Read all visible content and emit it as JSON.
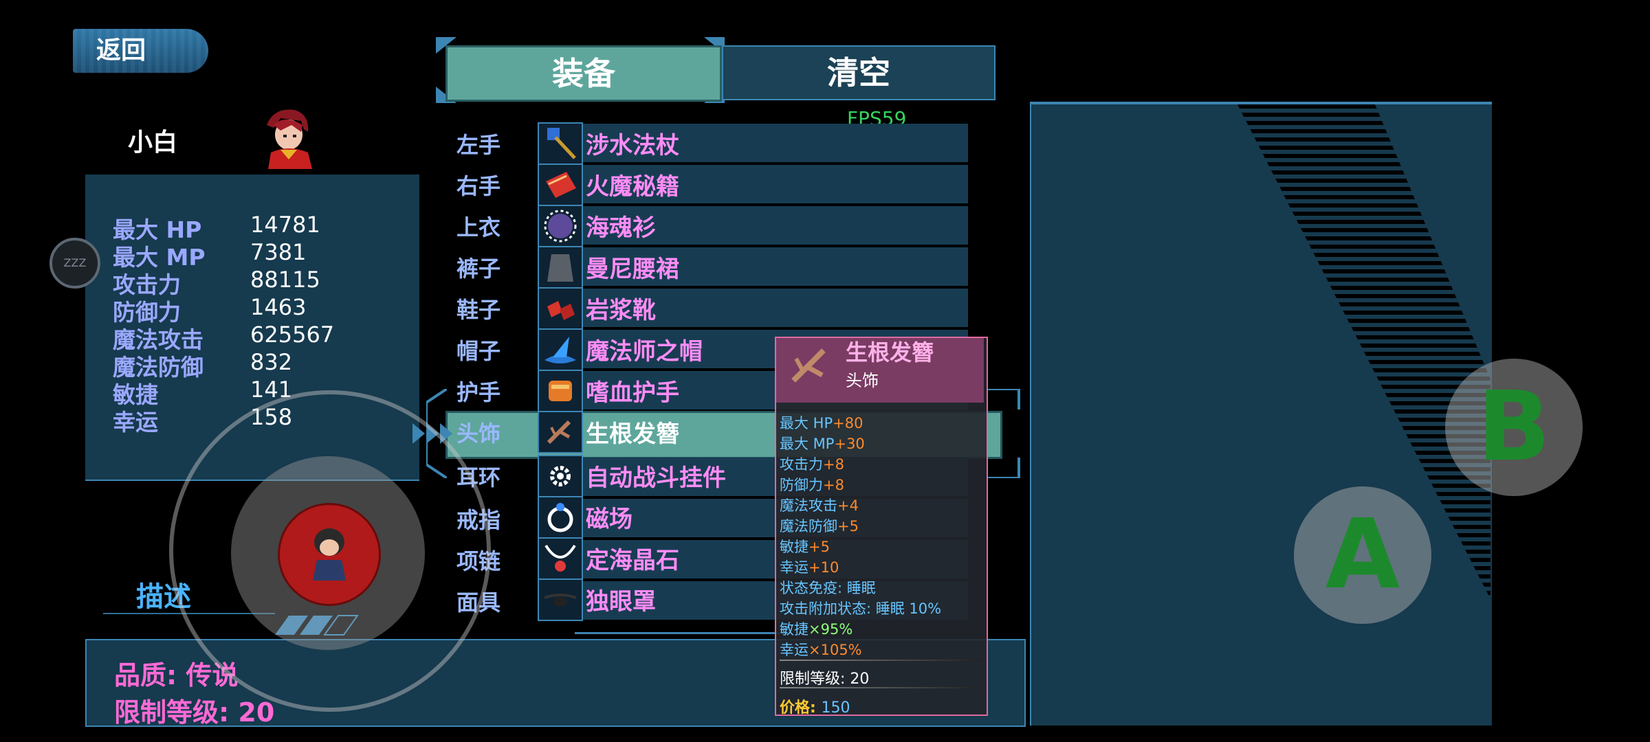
{
  "header": {
    "back_label": "返回",
    "tabs": [
      {
        "label": "装备",
        "active": true
      },
      {
        "label": "清空",
        "active": false
      }
    ],
    "fps": "FPS59"
  },
  "character": {
    "name": "小白",
    "stats": [
      {
        "label": "最大 HP",
        "value": "14781"
      },
      {
        "label": "最大 MP",
        "value": "7381"
      },
      {
        "label": "攻击力",
        "value": "88115"
      },
      {
        "label": "防御力",
        "value": "1463"
      },
      {
        "label": "魔法攻击",
        "value": "625567"
      },
      {
        "label": "魔法防御",
        "value": "832"
      },
      {
        "label": "敏捷",
        "value": "141"
      },
      {
        "label": "幸运",
        "value": "158"
      }
    ]
  },
  "equipment": {
    "slots": [
      {
        "slot": "左手",
        "item": "涉水法杖",
        "icon": "staff-icon"
      },
      {
        "slot": "右手",
        "item": "火魔秘籍",
        "icon": "spellbook-icon"
      },
      {
        "slot": "上衣",
        "item": "海魂衫",
        "icon": "shirt-icon"
      },
      {
        "slot": "裤子",
        "item": "曼尼腰裙",
        "icon": "skirt-icon"
      },
      {
        "slot": "鞋子",
        "item": "岩浆靴",
        "icon": "boots-icon"
      },
      {
        "slot": "帽子",
        "item": "魔法师之帽",
        "icon": "wizard-hat-icon"
      },
      {
        "slot": "护手",
        "item": "嗜血护手",
        "icon": "gauntlet-icon"
      },
      {
        "slot": "头饰",
        "item": "生根发簪",
        "icon": "hairpin-icon",
        "selected": true
      },
      {
        "slot": "耳环",
        "item": "自动战斗挂件",
        "icon": "gear-pendant-icon"
      },
      {
        "slot": "戒指",
        "item": "磁场",
        "icon": "ring-icon"
      },
      {
        "slot": "项链",
        "item": "定海晶石",
        "icon": "necklace-icon"
      },
      {
        "slot": "面具",
        "item": "独眼罩",
        "icon": "eyepatch-icon"
      }
    ]
  },
  "tooltip": {
    "name": "生根发簪",
    "type": "头饰",
    "lines": [
      {
        "label": "最大 HP",
        "value": "+80"
      },
      {
        "label": "最大 MP",
        "value": "+30"
      },
      {
        "label": "攻击力",
        "value": "+8"
      },
      {
        "label": "防御力",
        "value": "+8"
      },
      {
        "label": "魔法攻击",
        "value": "+4"
      },
      {
        "label": "魔法防御",
        "value": "+5"
      },
      {
        "label": "敏捷",
        "value": "+5"
      },
      {
        "label": "幸运",
        "value": "+10"
      },
      {
        "label": "状态免疫: 睡眠",
        "value": ""
      },
      {
        "label": "攻击附加状态: 睡眠 10%",
        "value": ""
      },
      {
        "label": "敏捷",
        "value": "×95%",
        "style": "grn"
      },
      {
        "label": "幸运",
        "value": "×105%",
        "style": "org"
      }
    ],
    "level_label": "限制等级:",
    "level_value": "20",
    "price_label": "价格:",
    "price_value": "150"
  },
  "description": {
    "title": "描述",
    "quality_line": "品质: 传说",
    "level_line": "限制等级: 20"
  },
  "controls": {
    "sleep_icon_text": "ZZZ",
    "button_a": "A",
    "button_b": "B"
  },
  "colors": {
    "panel": "#163a4e",
    "border": "#3d86b3",
    "selected": "#5ea69c",
    "item_name": "#ff8cf5",
    "slot_label": "#9ab8ff"
  }
}
